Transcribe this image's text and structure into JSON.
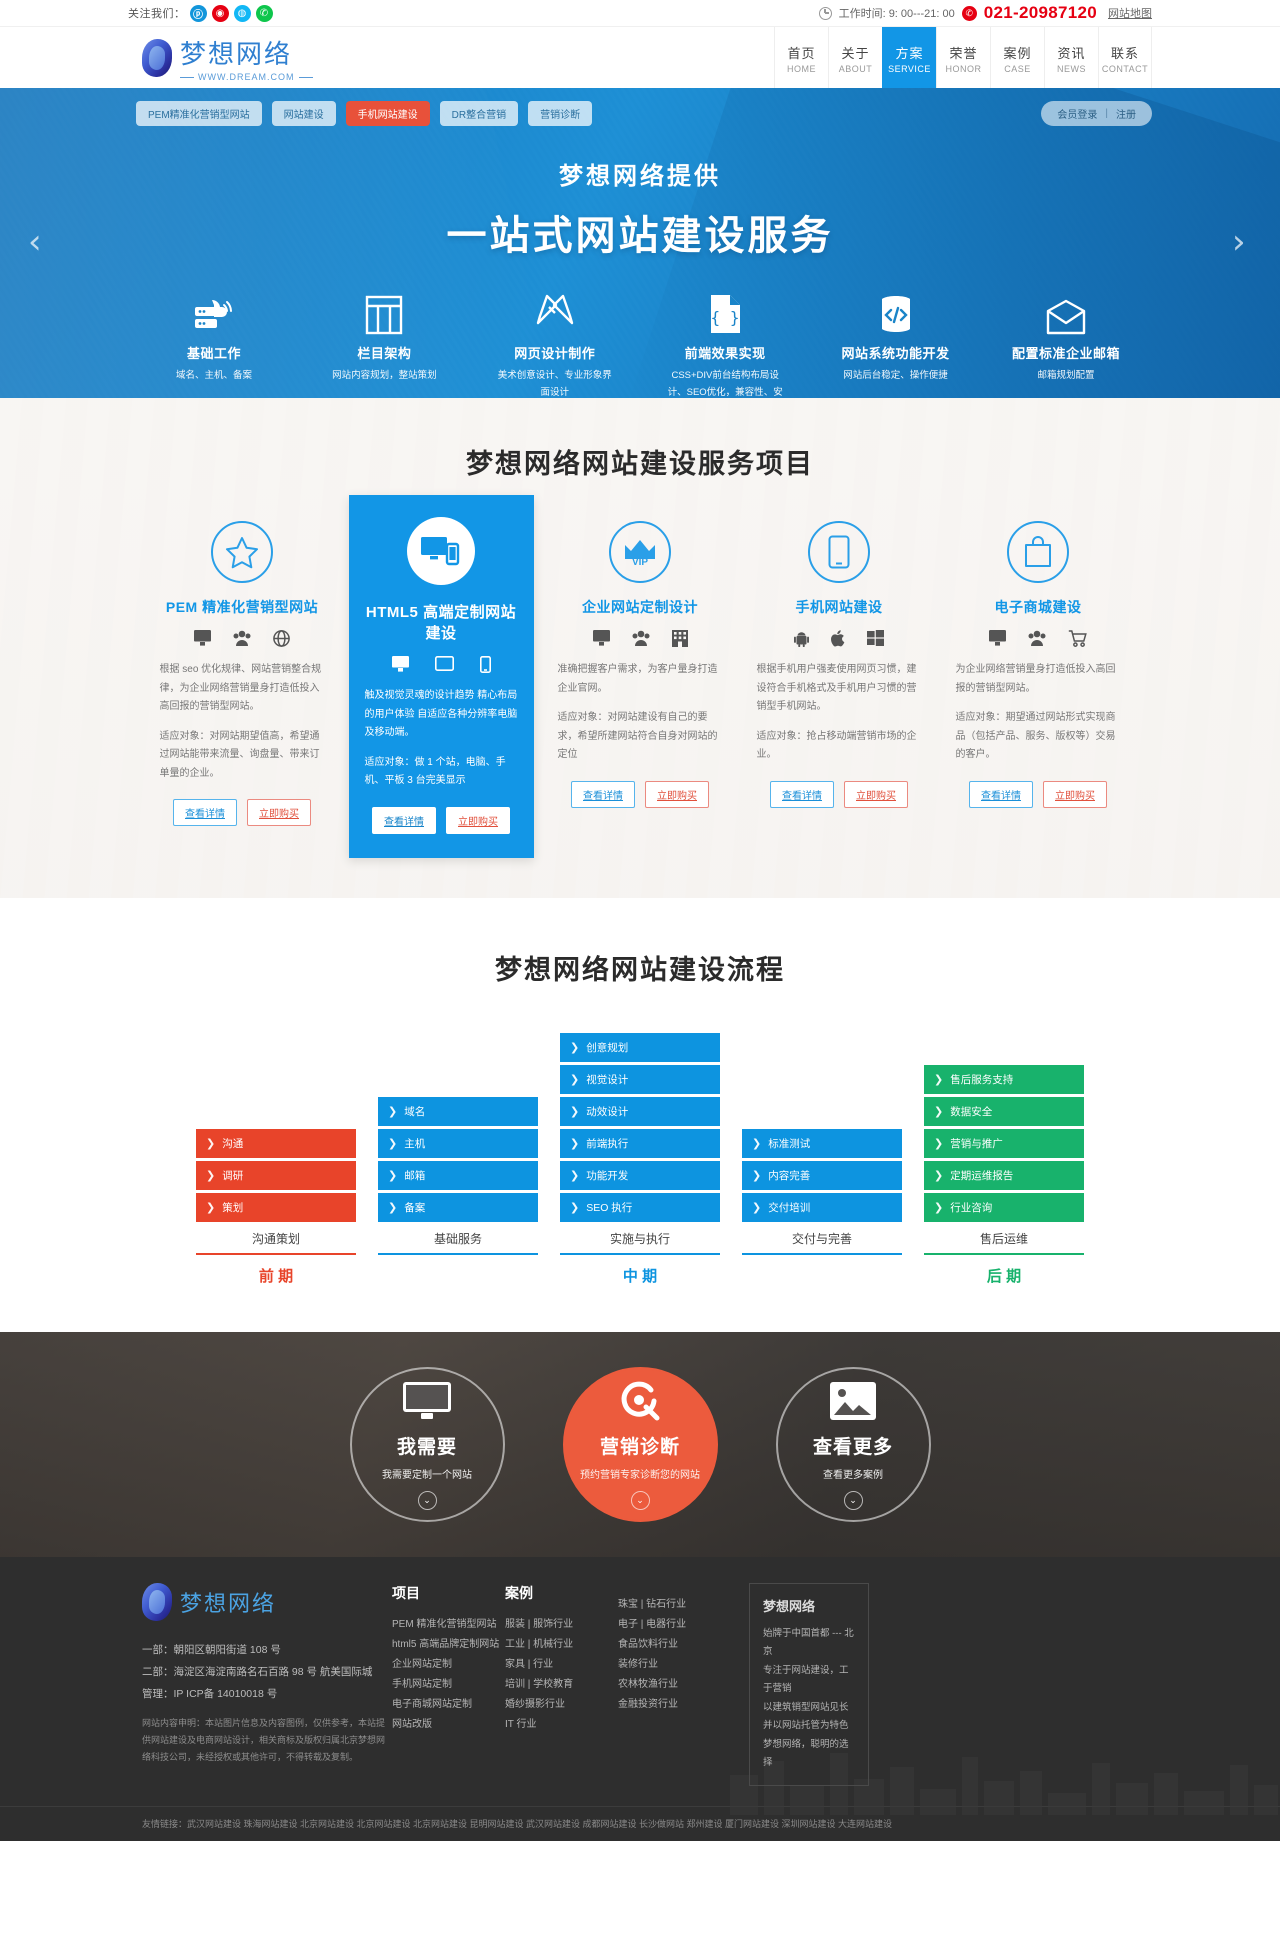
{
  "topbar": {
    "follow_label": "关注我们：",
    "social": [
      {
        "name": "baidu-icon",
        "glyph": "ⓟ",
        "color": "#1296db"
      },
      {
        "name": "weibo-icon",
        "glyph": "◉",
        "color": "#e60012"
      },
      {
        "name": "qq-icon",
        "glyph": "◍",
        "color": "#12b7f5"
      },
      {
        "name": "wechat-icon",
        "glyph": "✆",
        "color": "#0ec64c"
      }
    ],
    "worktime": "工作时间: 9: 00---21: 00",
    "phone": "021-20987120",
    "sitemap": "网站地图"
  },
  "header": {
    "logo_cn": "梦想网络",
    "logo_en": "WWW.DREAM.COM",
    "nav": [
      {
        "cn": "首页",
        "en": "HOME",
        "active": false
      },
      {
        "cn": "关于",
        "en": "ABOUT",
        "active": false
      },
      {
        "cn": "方案",
        "en": "SERVICE",
        "active": true
      },
      {
        "cn": "荣誉",
        "en": "HONOR",
        "active": false
      },
      {
        "cn": "案例",
        "en": "CASE",
        "active": false
      },
      {
        "cn": "资讯",
        "en": "NEWS",
        "active": false
      },
      {
        "cn": "联系",
        "en": "CONTACT",
        "active": false
      }
    ]
  },
  "hero": {
    "tags": [
      {
        "label": "PEM精准化营销型网站",
        "hot": false
      },
      {
        "label": "网站建设",
        "hot": false
      },
      {
        "label": "手机网站建设",
        "hot": true
      },
      {
        "label": "DR整合营销",
        "hot": false
      },
      {
        "label": "营销诊断",
        "hot": false
      }
    ],
    "login_label": "会员登录",
    "divider": "|",
    "register_label": "注册",
    "subtitle": "梦想网络提供",
    "title": "一站式网站建设服务",
    "prev_arrow": "‹",
    "next_arrow": "›",
    "features": [
      {
        "icon": "server-cloud-icon",
        "name": "基础工作",
        "desc": "域名、主机、备案"
      },
      {
        "icon": "columns-icon",
        "name": "栏目架构",
        "desc": "网站内容规划，整站策划"
      },
      {
        "icon": "pen-ruler-icon",
        "name": "网页设计制作",
        "desc": "美术创意设计、专业形象界面设计"
      },
      {
        "icon": "code-file-icon",
        "name": "前端效果实现",
        "desc": "CSS+DIV前台结构布局设计、SEO优化，兼容性、安全性、命名规范"
      },
      {
        "icon": "code-brackets-icon",
        "name": "网站系统功能开发",
        "desc": "网站后台稳定、操作便捷"
      },
      {
        "icon": "mail-icon",
        "name": "配置标准企业邮箱",
        "desc": "邮箱规划配置"
      }
    ]
  },
  "services": {
    "title": "梦想网络网站建设服务项目",
    "cards": [
      {
        "icon": "star-icon",
        "title": "PEM 精准化营销型网站",
        "featured": false,
        "mini_icons": [
          "monitor-icon",
          "users-icon",
          "globe-icon"
        ],
        "desc": [
          "根据 seo 优化规律、网站营销整合规律，为企业网络营销量身打造低投入高回报的营销型网站。",
          "适应对象：对网站期望值高，希望通过网站能带来流量、询盘量、带来订单量的企业。"
        ],
        "detail_label": "查看详情",
        "buy_label": "立即购买"
      },
      {
        "icon": "responsive-devices-icon",
        "title": "HTML5 高端定制网站建设",
        "featured": true,
        "mini_icons": [
          "monitor-icon",
          "tablet-icon",
          "phone-icon"
        ],
        "desc": [
          "触及视觉灵魂的设计趋势 精心布局的用户体验 自适应各种分辨率电脑及移动端。",
          "适应对象：做 1 个站，电脑、手机、平板 3 台完美显示"
        ],
        "detail_label": "查看详情",
        "buy_label": "立即购买"
      },
      {
        "icon": "vip-crown-icon",
        "title": "企业网站定制设计",
        "featured": false,
        "mini_icons": [
          "monitor-icon",
          "users-icon",
          "building-icon"
        ],
        "desc": [
          "准确把握客户需求，为客户量身打造企业官网。",
          "适应对象：对网站建设有自己的要求，希望所建网站符合自身对网站的定位"
        ],
        "detail_label": "查看详情",
        "buy_label": "立即购买"
      },
      {
        "icon": "mobile-icon",
        "title": "手机网站建设",
        "featured": false,
        "mini_icons": [
          "android-icon",
          "apple-icon",
          "windows-icon"
        ],
        "desc": [
          "根据手机用户强麦使用网页习惯，建设符合手机格式及手机用户习惯的营销型手机网站。",
          "适应对象：抢占移动端营销市场的企业。"
        ],
        "detail_label": "查看详情",
        "buy_label": "立即购买"
      },
      {
        "icon": "shopping-bag-icon",
        "title": "电子商城建设",
        "featured": false,
        "mini_icons": [
          "monitor-icon",
          "users-icon",
          "cart-icon"
        ],
        "desc": [
          "为企业网络营销量身打造低投入高回报的营销型网站。",
          "适应对象：期望通过网站形式实现商品（包括产品、服务、版权等）交易的客户。"
        ],
        "detail_label": "查看详情",
        "buy_label": "立即购买"
      }
    ]
  },
  "process": {
    "title": "梦想网络网站建设流程",
    "columns": [
      {
        "color": "red",
        "items": [
          "沟通",
          "调研",
          "策划"
        ],
        "footer": "沟通策划",
        "phase": "前 期",
        "phase_color": "red"
      },
      {
        "color": "blue",
        "items": [
          "域名",
          "主机",
          "邮箱",
          "备案"
        ],
        "footer": "基础服务",
        "phase": "",
        "phase_color": "blue"
      },
      {
        "color": "blue",
        "items": [
          "创意规划",
          "视觉设计",
          "动效设计",
          "前端执行",
          "功能开发",
          "SEO 执行"
        ],
        "footer": "实施与执行",
        "phase": "中 期",
        "phase_color": "blue"
      },
      {
        "color": "blue",
        "items": [
          "标准测试",
          "内容完善",
          "交付培训"
        ],
        "footer": "交付与完善",
        "phase": "",
        "phase_color": "blue"
      },
      {
        "color": "green",
        "items": [
          "售后服务支持",
          "数据安全",
          "营销与推广",
          "定期运维报告",
          "行业咨询"
        ],
        "footer": "售后运维",
        "phase": "后 期",
        "phase_color": "green"
      }
    ],
    "chevron": "❯"
  },
  "cta": {
    "items": [
      {
        "icon": "monitor-icon",
        "title": "我需要",
        "desc": "我需要定制一个网站",
        "accent": false,
        "chevron": "⌄"
      },
      {
        "icon": "diagnosis-icon",
        "title": "营销诊断",
        "desc": "预约营销专家诊断您的网站",
        "accent": true,
        "chevron": "⌄"
      },
      {
        "icon": "image-icon",
        "title": "查看更多",
        "desc": "查看更多案例",
        "accent": false,
        "chevron": "⌄"
      }
    ]
  },
  "footer": {
    "logo_cn": "梦想网络",
    "address_1": "一部：朝阳区朝阳街道 108 号",
    "address_2": "二部：海淀区海淀南路名石百路 98 号 航美国际城",
    "icp": "管理：IP ICP备 14010018 号",
    "legal": "网站内容申明：本站图片信息及内容图例，仅供参考，本站提供网站建设及电商网站设计，相关商标及版权归属北京梦想网络科技公司，未经授权或其他许可，不得转载及复制。",
    "columns": [
      {
        "heading": "项目",
        "items": [
          "PEM 精准化营销型网站",
          "html5 高端品牌定制网站",
          "企业网站定制",
          "手机网站定制",
          "电子商城网站定制",
          "网站改版"
        ]
      },
      {
        "heading": "案例",
        "items": [
          "服装 | 服饰行业",
          "工业 | 机械行业",
          "家具 | 行业",
          "培训 | 学校教育",
          "婚纱摄影行业",
          "IT 行业"
        ]
      },
      {
        "heading": "",
        "items": [
          "珠宝 | 钻石行业",
          "电子 | 电器行业",
          "食品饮料行业",
          "装修行业",
          "农林牧渔行业",
          "金融投资行业"
        ]
      }
    ],
    "about": {
      "heading": "梦想网络",
      "items": [
        "始牌于中国首都 --- 北京",
        "专注于网站建设，工于营销",
        "以建筑销型网站见长",
        "并以网站托管为特色",
        "梦想网络，聪明的选择"
      ]
    },
    "friend_label": "友情链接：",
    "friend_links": "武汉网站建设  珠海网站建设  北京网站建设  北京网站建设  北京网站建设  昆明网站建设  武汉网站建设  成都网站建设  长沙做网站  郑州建设  厦门网站建设  深圳网站建设  大连网站建设"
  }
}
